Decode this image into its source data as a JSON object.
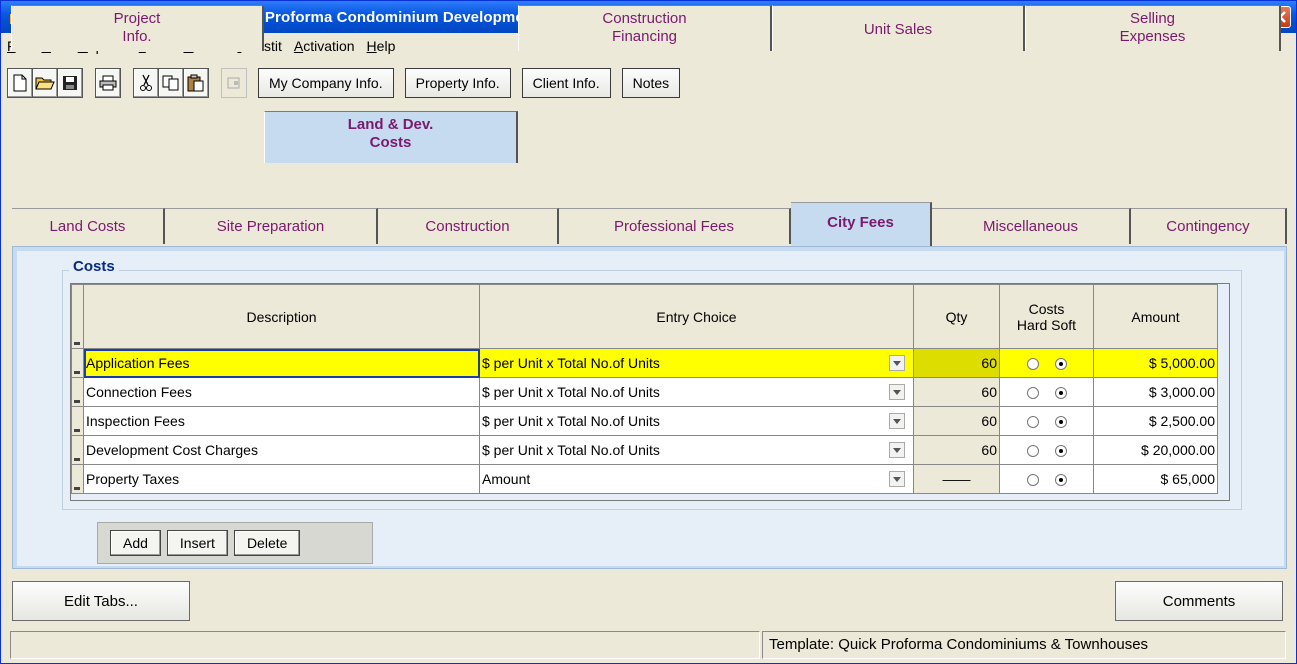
{
  "window": {
    "title": "Developer Express  CND - Quick Proforma Condominium Development  Express"
  },
  "menu": [
    "File",
    "Edit",
    "Reports",
    "Tools",
    "Utilites",
    "Investit",
    "Activation",
    "Help"
  ],
  "toolbar": {
    "my_company": "My Company Info.",
    "property": "Property Info.",
    "client": "Client Info.",
    "notes": "Notes"
  },
  "main_tabs": [
    {
      "label": "Project\nInfo."
    },
    {
      "label": "Land & Dev.\nCosts",
      "active": true
    },
    {
      "label": "Construction\nFinancing"
    },
    {
      "label": "Unit Sales"
    },
    {
      "label": "Selling\nExpenses"
    }
  ],
  "sub_tabs": [
    {
      "label": "Land Costs"
    },
    {
      "label": "Site Preparation"
    },
    {
      "label": "Construction"
    },
    {
      "label": "Professional Fees"
    },
    {
      "label": "City Fees",
      "active": true
    },
    {
      "label": "Miscellaneous"
    },
    {
      "label": "Contingency"
    }
  ],
  "costs": {
    "group_title": "Costs",
    "columns": {
      "description": "Description",
      "entry_choice": "Entry Choice",
      "qty": "Qty",
      "costs_line1": "Costs",
      "costs_line2": "Hard Soft",
      "amount": "Amount"
    },
    "rows": [
      {
        "description": "Application Fees",
        "entry_choice": "$ per Unit x Total No.of Units",
        "qty": "60",
        "hard": false,
        "soft": true,
        "amount": "$ 5,000.00",
        "selected": true
      },
      {
        "description": "Connection Fees",
        "entry_choice": "$ per Unit x Total No.of Units",
        "qty": "60",
        "hard": false,
        "soft": true,
        "amount": "$ 3,000.00"
      },
      {
        "description": "Inspection Fees",
        "entry_choice": "$ per Unit x Total No.of Units",
        "qty": "60",
        "hard": false,
        "soft": true,
        "amount": "$ 2,500.00"
      },
      {
        "description": "Development Cost Charges",
        "entry_choice": "$ per Unit x Total No.of Units",
        "qty": "60",
        "hard": false,
        "soft": true,
        "amount": "$ 20,000.00"
      },
      {
        "description": "Property  Taxes",
        "entry_choice": "Amount",
        "qty": "——",
        "hard": false,
        "soft": true,
        "amount": "$ 65,000"
      }
    ],
    "buttons": {
      "add": "Add",
      "insert": "Insert",
      "delete": "Delete"
    }
  },
  "bottom": {
    "edit_tabs": "Edit Tabs...",
    "comments": "Comments"
  },
  "status": {
    "left": "",
    "template": "Template: Quick Proforma Condominiums & Townhouses"
  }
}
